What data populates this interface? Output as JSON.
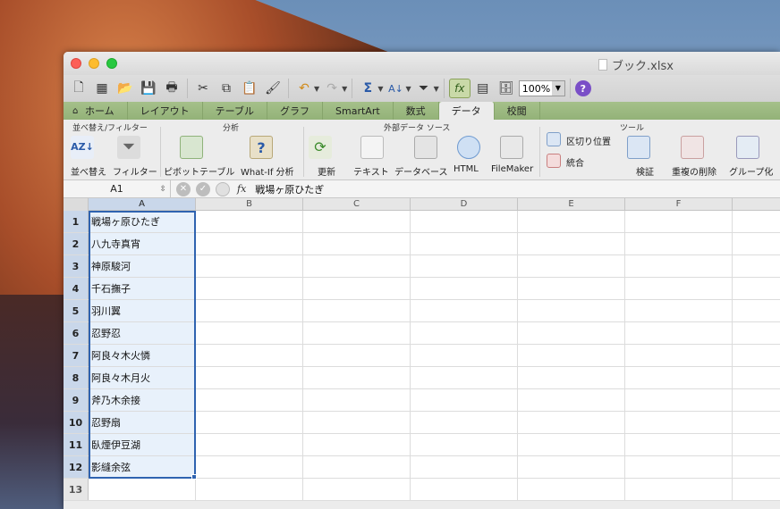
{
  "window": {
    "title": "ブック.xlsx"
  },
  "toolbar": {
    "zoom": "100%"
  },
  "tabs": [
    {
      "label": "ホーム",
      "active": false
    },
    {
      "label": "レイアウト",
      "active": false
    },
    {
      "label": "テーブル",
      "active": false
    },
    {
      "label": "グラフ",
      "active": false
    },
    {
      "label": "SmartArt",
      "active": false
    },
    {
      "label": "数式",
      "active": false
    },
    {
      "label": "データ",
      "active": true
    },
    {
      "label": "校閲",
      "active": false
    }
  ],
  "ribbon": {
    "groups": {
      "sort_filter": "並べ替え/フィルター",
      "analysis": "分析",
      "external": "外部データ ソース",
      "tools": "ツール"
    },
    "buttons": {
      "sort": "並べ替え",
      "filter": "フィルター",
      "pivot": "ピボットテーブル",
      "whatif": "What-If 分析",
      "refresh": "更新",
      "text": "テキスト",
      "database": "データベース",
      "html": "HTML",
      "filemaker": "FileMaker",
      "text_to_columns": "区切り位置",
      "consolidate": "統合",
      "validate": "検証",
      "remove_duplicates": "重複の削除",
      "group": "グループ化"
    }
  },
  "formula_bar": {
    "name_box": "A1",
    "fx": "fx",
    "value": "戦場ヶ原ひたぎ"
  },
  "grid": {
    "columns": [
      "A",
      "B",
      "C",
      "D",
      "E",
      "F"
    ],
    "rows": [
      {
        "num": "1",
        "a": "戦場ヶ原ひたぎ"
      },
      {
        "num": "2",
        "a": "八九寺真宵"
      },
      {
        "num": "3",
        "a": "神原駿河"
      },
      {
        "num": "4",
        "a": "千石撫子"
      },
      {
        "num": "5",
        "a": "羽川翼"
      },
      {
        "num": "6",
        "a": "忍野忍"
      },
      {
        "num": "7",
        "a": "阿良々木火憐"
      },
      {
        "num": "8",
        "a": "阿良々木月火"
      },
      {
        "num": "9",
        "a": "斧乃木余接"
      },
      {
        "num": "10",
        "a": "忍野扇"
      },
      {
        "num": "11",
        "a": "臥煙伊豆湖"
      },
      {
        "num": "12",
        "a": "影縫余弦"
      },
      {
        "num": "13",
        "a": ""
      }
    ]
  }
}
